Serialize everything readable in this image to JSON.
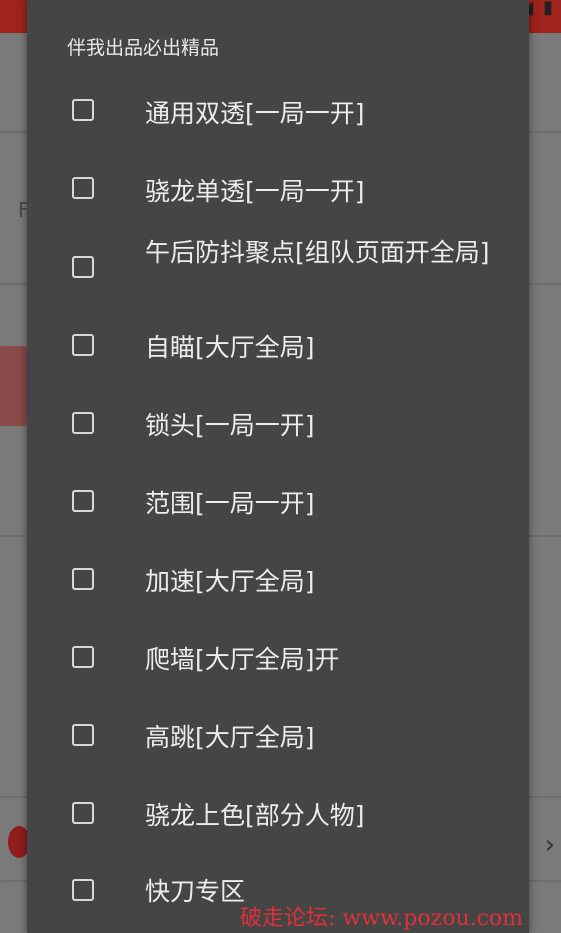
{
  "dialog": {
    "title": "伴我出品必出精品",
    "options": [
      {
        "label": "通用双透[一局一开]",
        "checked": false
      },
      {
        "label": "骁龙单透[一局一开]",
        "checked": false
      },
      {
        "label": "午后防抖聚点[组队页面开全局]",
        "checked": false
      },
      {
        "label": "自瞄[大厅全局]",
        "checked": false
      },
      {
        "label": "锁头[一局一开]",
        "checked": false
      },
      {
        "label": "范围[一局一开]",
        "checked": false
      },
      {
        "label": "加速[大厅全局]",
        "checked": false
      },
      {
        "label": "爬墙[大厅全局]开",
        "checked": false
      },
      {
        "label": "高跳[大厅全局]",
        "checked": false
      },
      {
        "label": "骁龙上色[部分人物]",
        "checked": false
      },
      {
        "label": "快刀专区",
        "checked": false
      }
    ]
  },
  "watermark": "破走论坛: www.pozou.com",
  "colors": {
    "dialog_bg": "#454545",
    "overlay_bg": "#7a7a7a",
    "topbar": "#a0231d",
    "watermark": "#e0303a",
    "text": "#ececec"
  },
  "icons": {
    "status": "signal-battery-icons",
    "chevron": "chevron-right-icon",
    "bg_app_icon": "red-app-icon"
  }
}
